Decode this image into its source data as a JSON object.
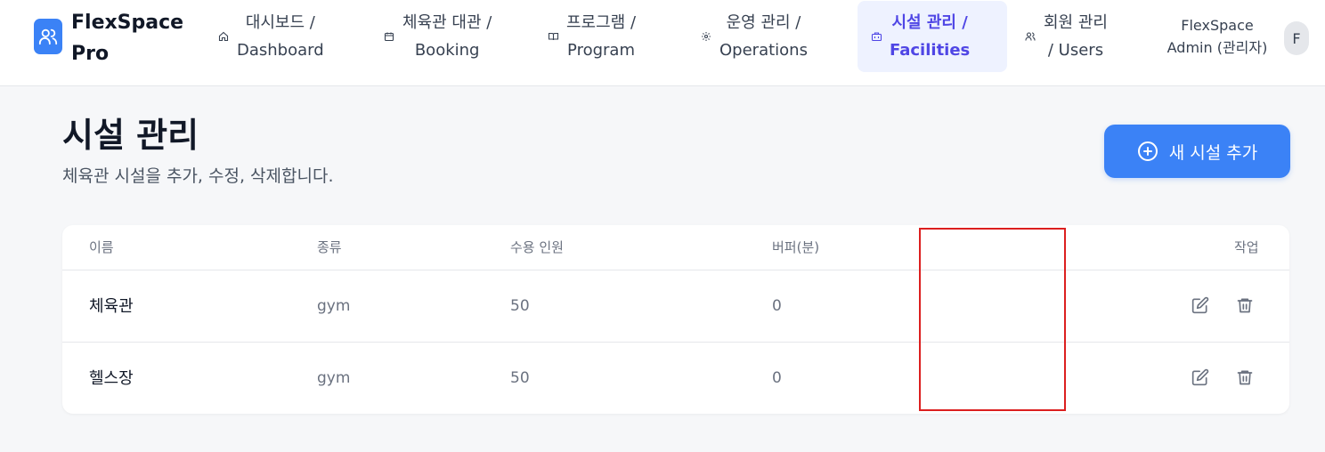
{
  "brand": {
    "name": "FlexSpace\nPro",
    "logo_icon": "users-icon",
    "accent": "#3b82f6"
  },
  "nav": {
    "items": [
      {
        "label": "대시보드 /\nDashboard",
        "icon": "home-icon"
      },
      {
        "label": "체육관 대관 /\nBooking",
        "icon": "calendar-icon"
      },
      {
        "label": "프로그램 /\nProgram",
        "icon": "book-icon"
      },
      {
        "label": "운영 관리 /\nOperations",
        "icon": "gear-icon"
      },
      {
        "label": "시설 관리 /\nFacilities",
        "icon": "building-icon",
        "active": true
      },
      {
        "label": "회원 관리\n/ Users",
        "icon": "users-icon"
      }
    ]
  },
  "user": {
    "name": "FlexSpace\nAdmin (관리자)",
    "avatar_initial": "F"
  },
  "page": {
    "title": "시설 관리",
    "subtitle": "체육관 시설을 추가, 수정, 삭제합니다.",
    "add_button_label": "새 시설 추가"
  },
  "table": {
    "headers": {
      "name": "이름",
      "type": "종류",
      "capacity": "수용 인원",
      "buffer": "버퍼(분)",
      "actions": "작업"
    },
    "rows": [
      {
        "name": "체육관",
        "type": "gym",
        "capacity": "50",
        "buffer": "0"
      },
      {
        "name": "헬스장",
        "type": "gym",
        "capacity": "50",
        "buffer": "0"
      }
    ]
  },
  "colors": {
    "primary": "#3b82f6",
    "active_nav_text": "#4f46e5",
    "active_nav_bg": "#eef2ff",
    "highlight": "#dc1f1f"
  }
}
